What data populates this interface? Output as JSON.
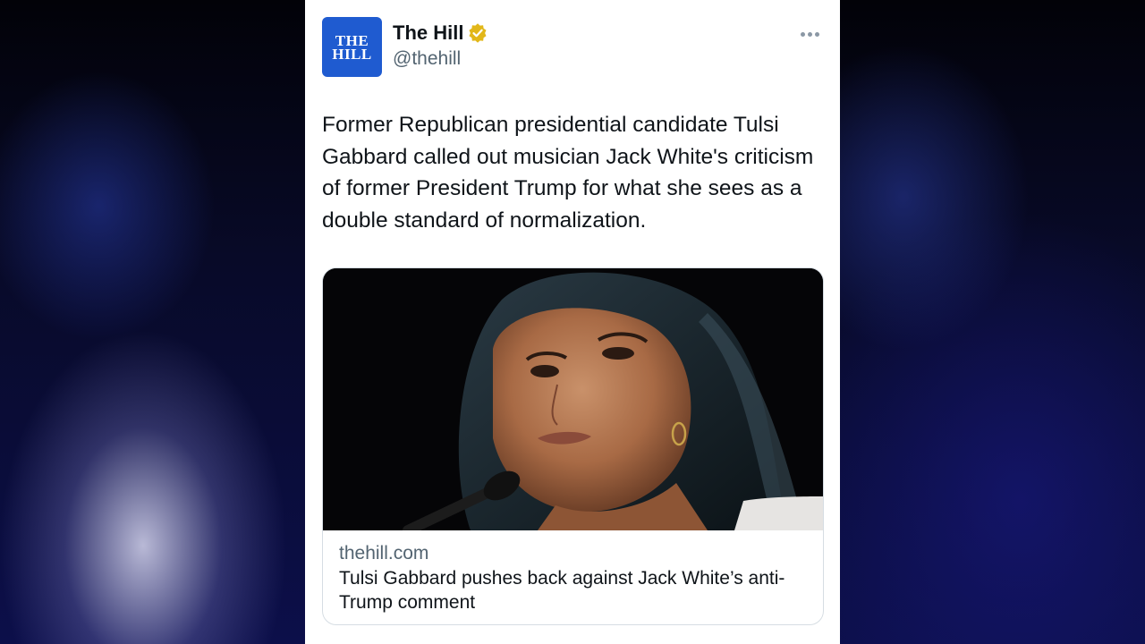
{
  "tweet": {
    "author": {
      "name": "The Hill",
      "handle": "@thehill",
      "avatar_line1": "THE",
      "avatar_line2": "HILL",
      "verified": true,
      "verified_color": "#e2b719",
      "avatar_color": "#1f5bd0"
    },
    "text": "Former Republican presidential candidate Tulsi Gabbard called out musician Jack White's criticism of former President Trump for what she sees as a double standard of normalization.",
    "more_icon": "ellipsis-icon",
    "link_card": {
      "domain": "thehill.com",
      "headline": "Tulsi Gabbard pushes back against Jack White’s anti-Trump comment"
    }
  }
}
